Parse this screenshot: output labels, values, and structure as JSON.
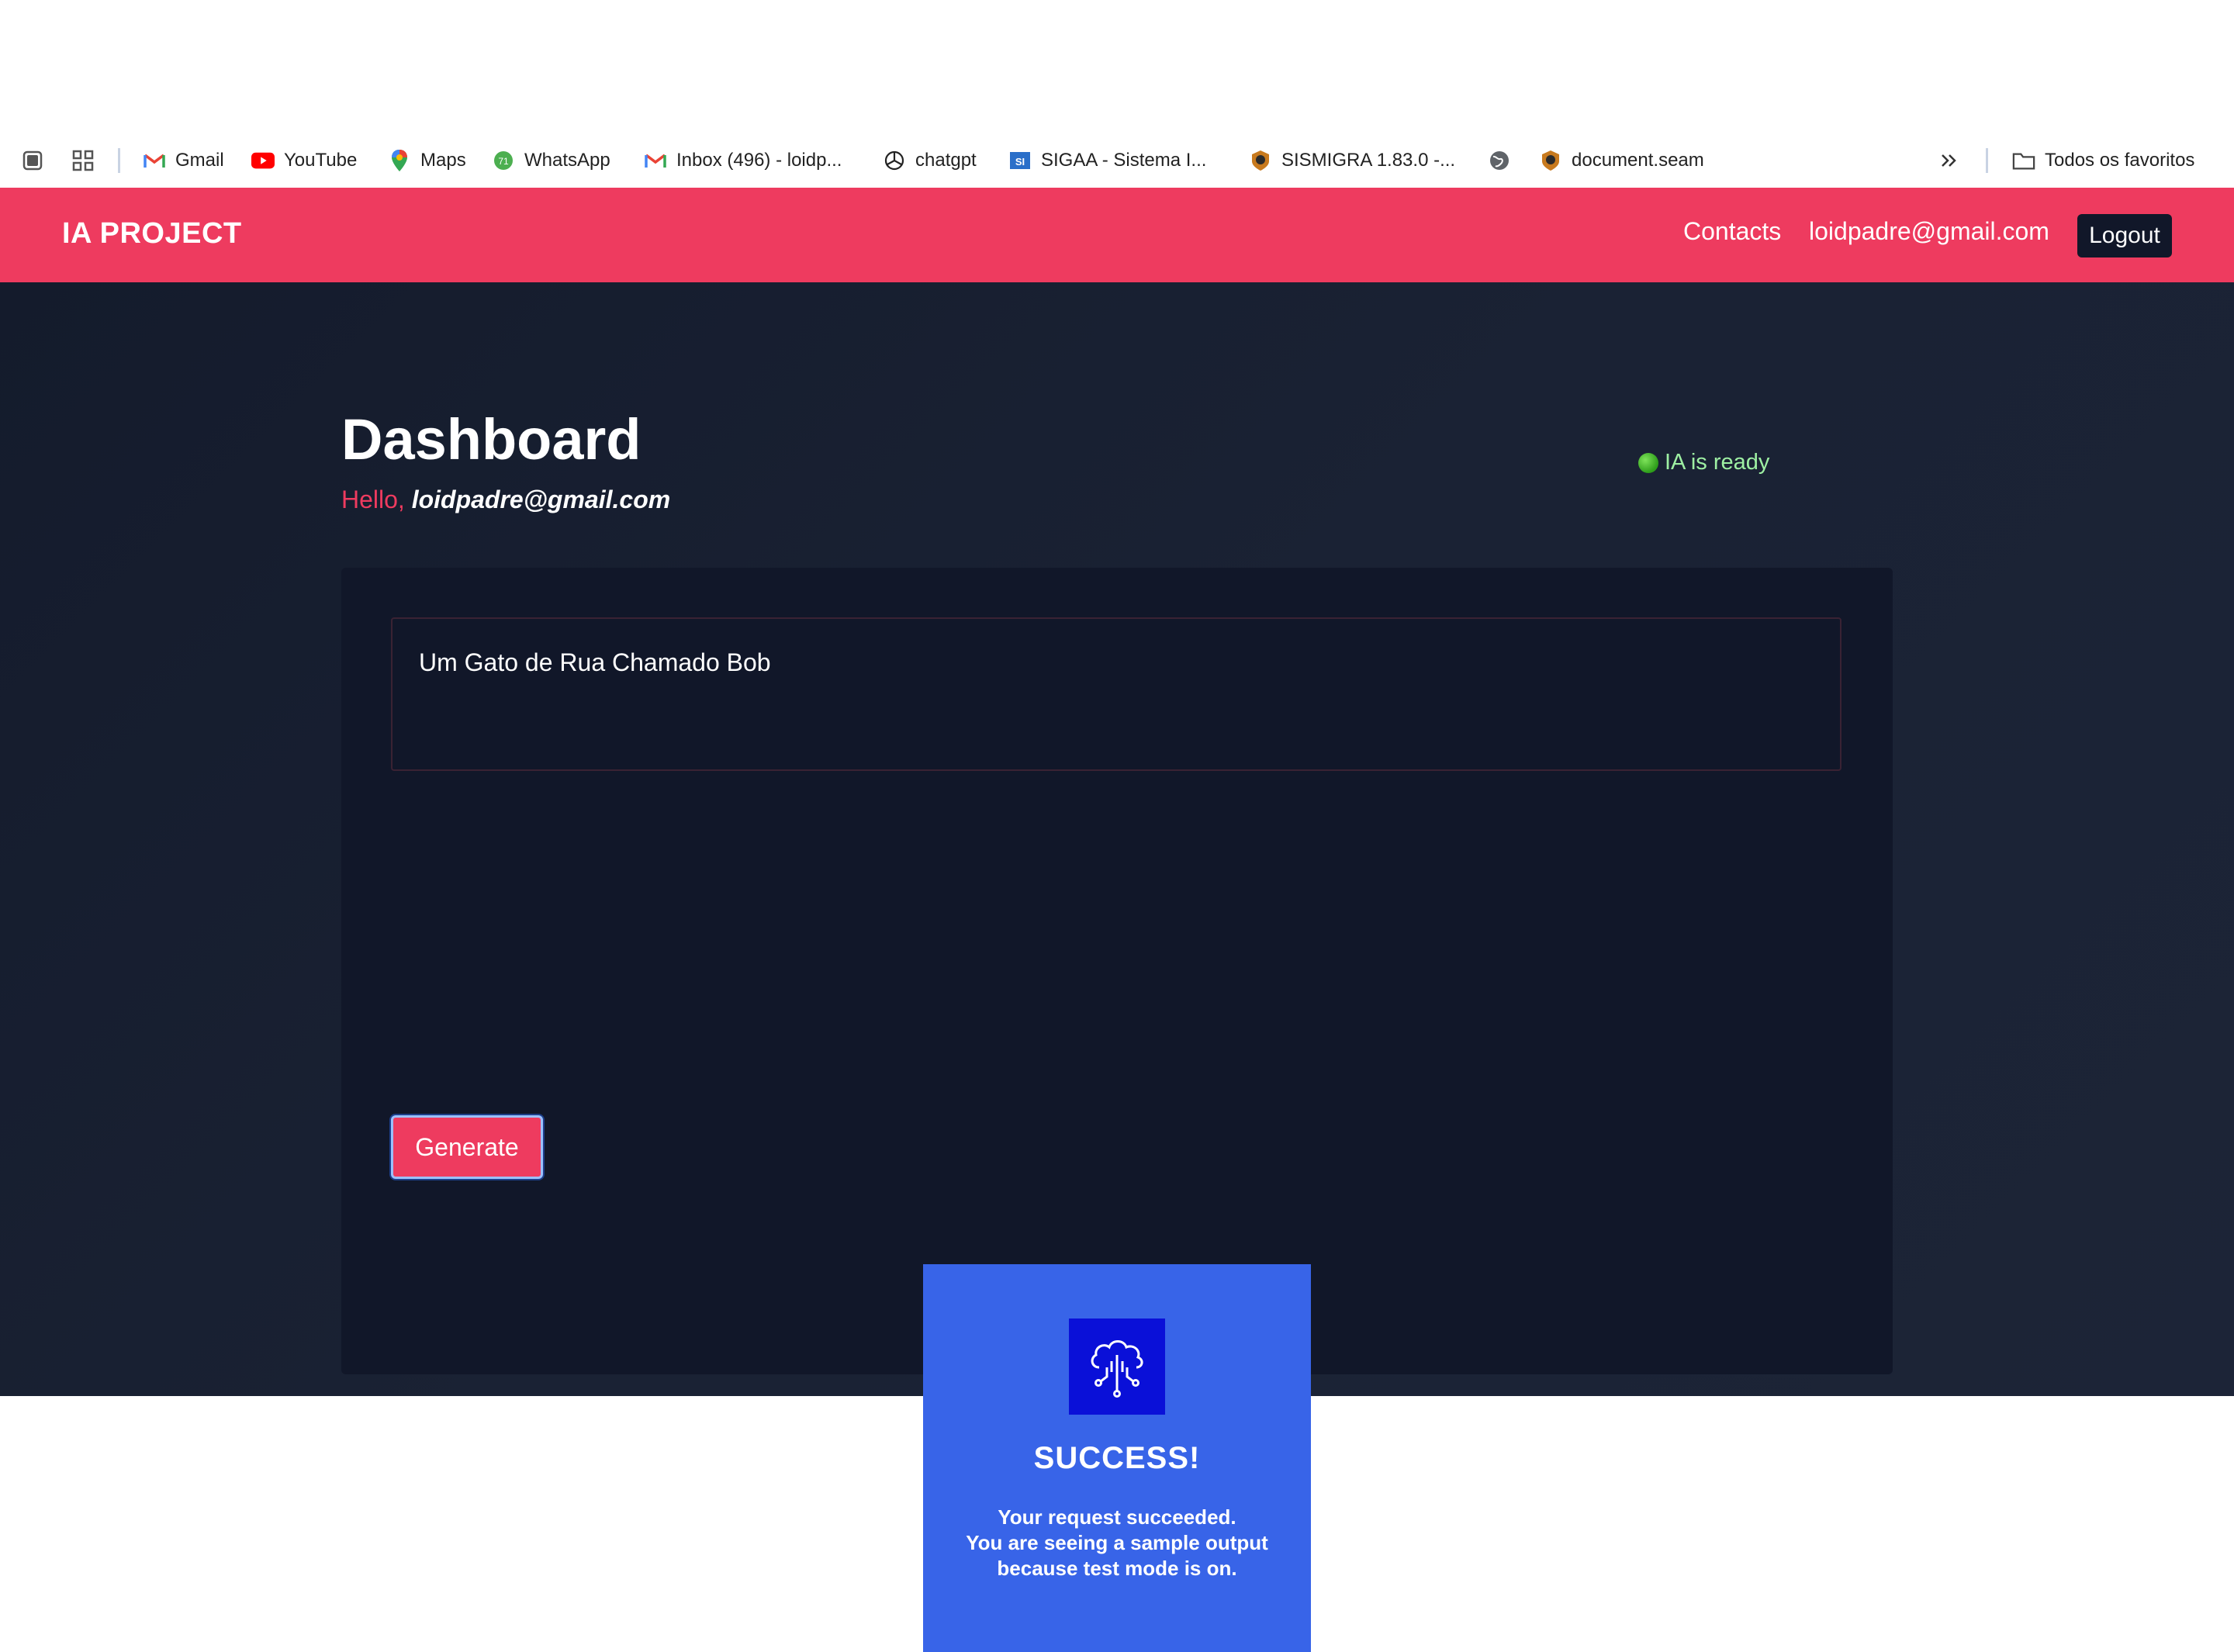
{
  "bookmarks": {
    "items": [
      {
        "label": "Gmail",
        "icon": "gmail-icon"
      },
      {
        "label": "YouTube",
        "icon": "youtube-icon"
      },
      {
        "label": "Maps",
        "icon": "maps-icon"
      },
      {
        "label": "WhatsApp",
        "icon": "whatsapp-icon"
      },
      {
        "label": "Inbox (496) - loidp...",
        "icon": "gmail-icon"
      },
      {
        "label": "chatgpt",
        "icon": "chatgpt-icon"
      },
      {
        "label": "SIGAA - Sistema I...",
        "icon": "sigaa-icon"
      },
      {
        "label": "SISMIGRA 1.83.0 -...",
        "icon": "sismigra-icon"
      },
      {
        "label": "document.seam",
        "icon": "sismigra-icon"
      }
    ],
    "all_bookmarks_label": "Todos os favoritos"
  },
  "navbar": {
    "brand": "IA PROJECT",
    "contacts_label": "Contacts",
    "user_email": "loidpadre@gmail.com",
    "logout_label": "Logout",
    "color": "#ee3b5f"
  },
  "dashboard": {
    "title": "Dashboard",
    "greeting_label": "Hello,",
    "greeting_email": "loidpadre@gmail.com",
    "status_text": "IA is ready",
    "prompt_value": "Um Gato de Rua Chamado Bob",
    "generate_label": "Generate"
  },
  "result": {
    "title": "SUCCESS!",
    "line1": "Your request succeeded.",
    "line2": "You are seeing a sample output",
    "line3": "because test mode is on.",
    "icon": "cloud-circuit-icon"
  }
}
